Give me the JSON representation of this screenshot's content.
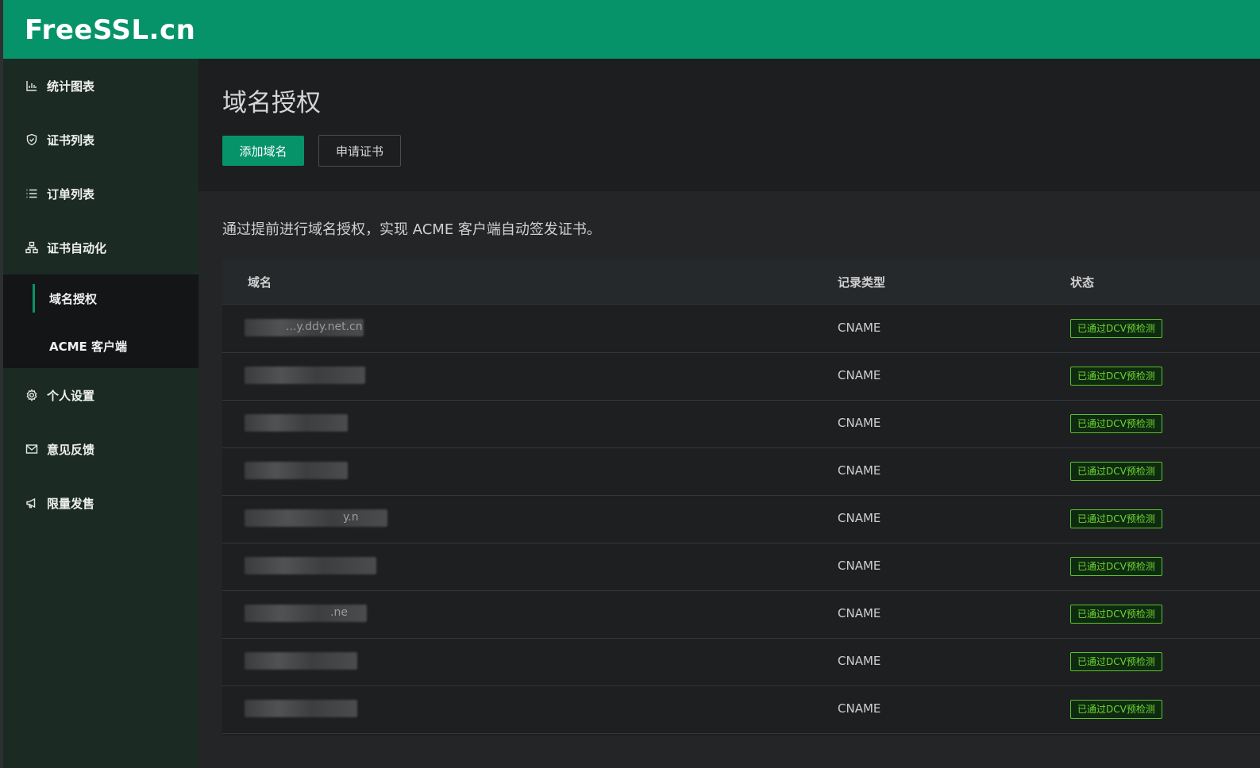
{
  "app": {
    "logo": "FreeSSL.cn"
  },
  "sidebar": {
    "items": [
      {
        "label": "统计图表",
        "icon": "bar-chart-icon"
      },
      {
        "label": "证书列表",
        "icon": "shield-icon"
      },
      {
        "label": "订单列表",
        "icon": "list-icon"
      },
      {
        "label": "证书自动化",
        "icon": "sitemap-icon"
      },
      {
        "label": "个人设置",
        "icon": "gear-icon"
      },
      {
        "label": "意见反馈",
        "icon": "mail-icon"
      },
      {
        "label": "限量发售",
        "icon": "megaphone-icon"
      }
    ],
    "submenu": [
      {
        "label": "域名授权",
        "active": true
      },
      {
        "label": "ACME 客户端",
        "active": false
      }
    ]
  },
  "main": {
    "title": "域名授权",
    "buttons": {
      "add_domain": "添加域名",
      "apply_cert": "申请证书"
    },
    "description": "通过提前进行域名授权，实现 ACME 客户端自动签发证书。",
    "table": {
      "headers": [
        "域名",
        "记录类型",
        "状态"
      ],
      "rows": [
        {
          "domain_visible": "...y.ddy.net.cn",
          "type": "CNAME",
          "status": "已通过DCV预检测"
        },
        {
          "domain_visible": "",
          "type": "CNAME",
          "status": "已通过DCV预检测"
        },
        {
          "domain_visible": "",
          "type": "CNAME",
          "status": "已通过DCV预检测"
        },
        {
          "domain_visible": "",
          "type": "CNAME",
          "status": "已通过DCV预检测"
        },
        {
          "domain_visible": "y.n",
          "type": "CNAME",
          "status": "已通过DCV预检测"
        },
        {
          "domain_visible": "",
          "type": "CNAME",
          "status": "已通过DCV预检测"
        },
        {
          "domain_visible": ".ne",
          "type": "CNAME",
          "status": "已通过DCV预检测"
        },
        {
          "domain_visible": "",
          "type": "CNAME",
          "status": "已通过DCV预检测"
        },
        {
          "domain_visible": "",
          "type": "CNAME",
          "status": "已通过DCV预检测"
        }
      ]
    }
  },
  "colors": {
    "brand": "#07936a",
    "status_green": "#6fd632"
  }
}
